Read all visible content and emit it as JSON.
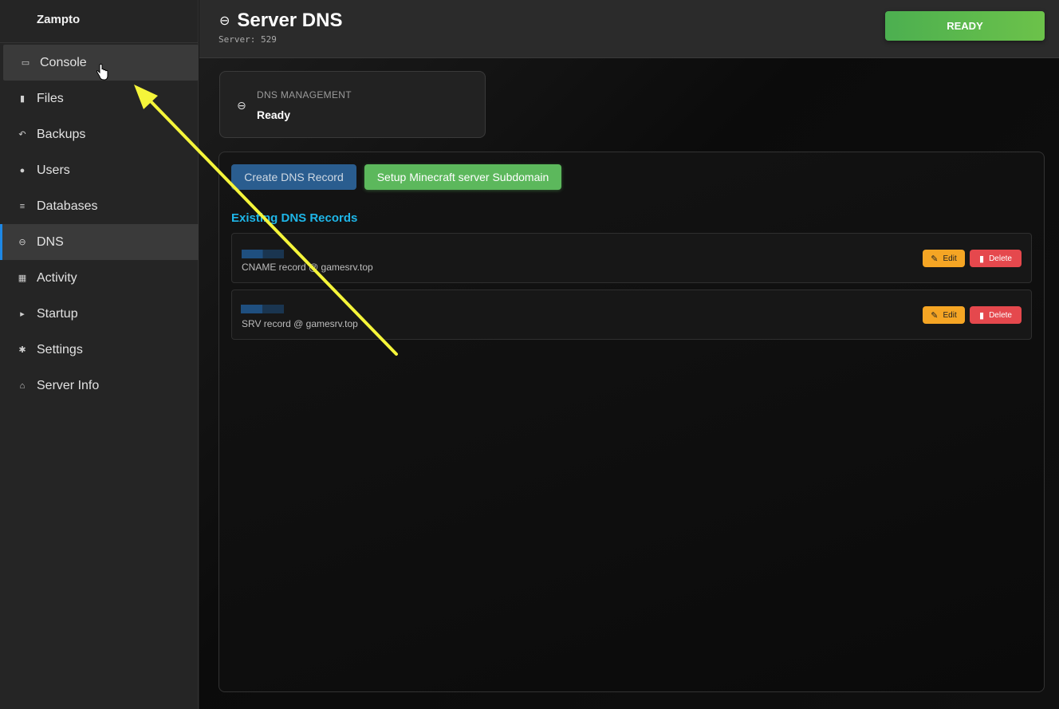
{
  "sidebar": {
    "brand": "Zampto",
    "items": [
      {
        "label": "Console",
        "icon": "console-icon",
        "glyph": "▭"
      },
      {
        "label": "Files",
        "icon": "file-icon",
        "glyph": "▮"
      },
      {
        "label": "Backups",
        "icon": "restore-icon",
        "glyph": "↶"
      },
      {
        "label": "Users",
        "icon": "user-icon",
        "glyph": "●"
      },
      {
        "label": "Databases",
        "icon": "database-icon",
        "glyph": "≡"
      },
      {
        "label": "DNS",
        "icon": "globe-icon",
        "glyph": "⊖"
      },
      {
        "label": "Activity",
        "icon": "dashboard-icon",
        "glyph": "▦"
      },
      {
        "label": "Startup",
        "icon": "play-icon",
        "glyph": "▸"
      },
      {
        "label": "Settings",
        "icon": "gear-icon",
        "glyph": "✱"
      },
      {
        "label": "Server Info",
        "icon": "home-icon",
        "glyph": "⌂"
      }
    ],
    "active": "DNS",
    "hovered": "Console"
  },
  "header": {
    "title": "Server DNS",
    "title_glyph": "⊖",
    "subtitle": "Server: 529",
    "status_button": "READY"
  },
  "status_card": {
    "label": "DNS MANAGEMENT",
    "value": "Ready",
    "glyph": "⊖"
  },
  "panel": {
    "create_button": "Create DNS Record",
    "setup_button": "Setup Minecraft server Subdomain",
    "section_title": "Existing DNS Records",
    "records": [
      {
        "description": "CNAME record @ gamesrv.top",
        "edit": "Edit",
        "delete": "Delete"
      },
      {
        "description": "SRV record @ gamesrv.top",
        "edit": "Edit",
        "delete": "Delete"
      }
    ]
  },
  "colors": {
    "accent_blue": "#1e88e5",
    "ready_green": "#5cb85c",
    "edit_orange": "#f5a524",
    "delete_red": "#e5484d",
    "section_title": "#1eb6e8",
    "annotation_arrow": "#f5f53a"
  }
}
